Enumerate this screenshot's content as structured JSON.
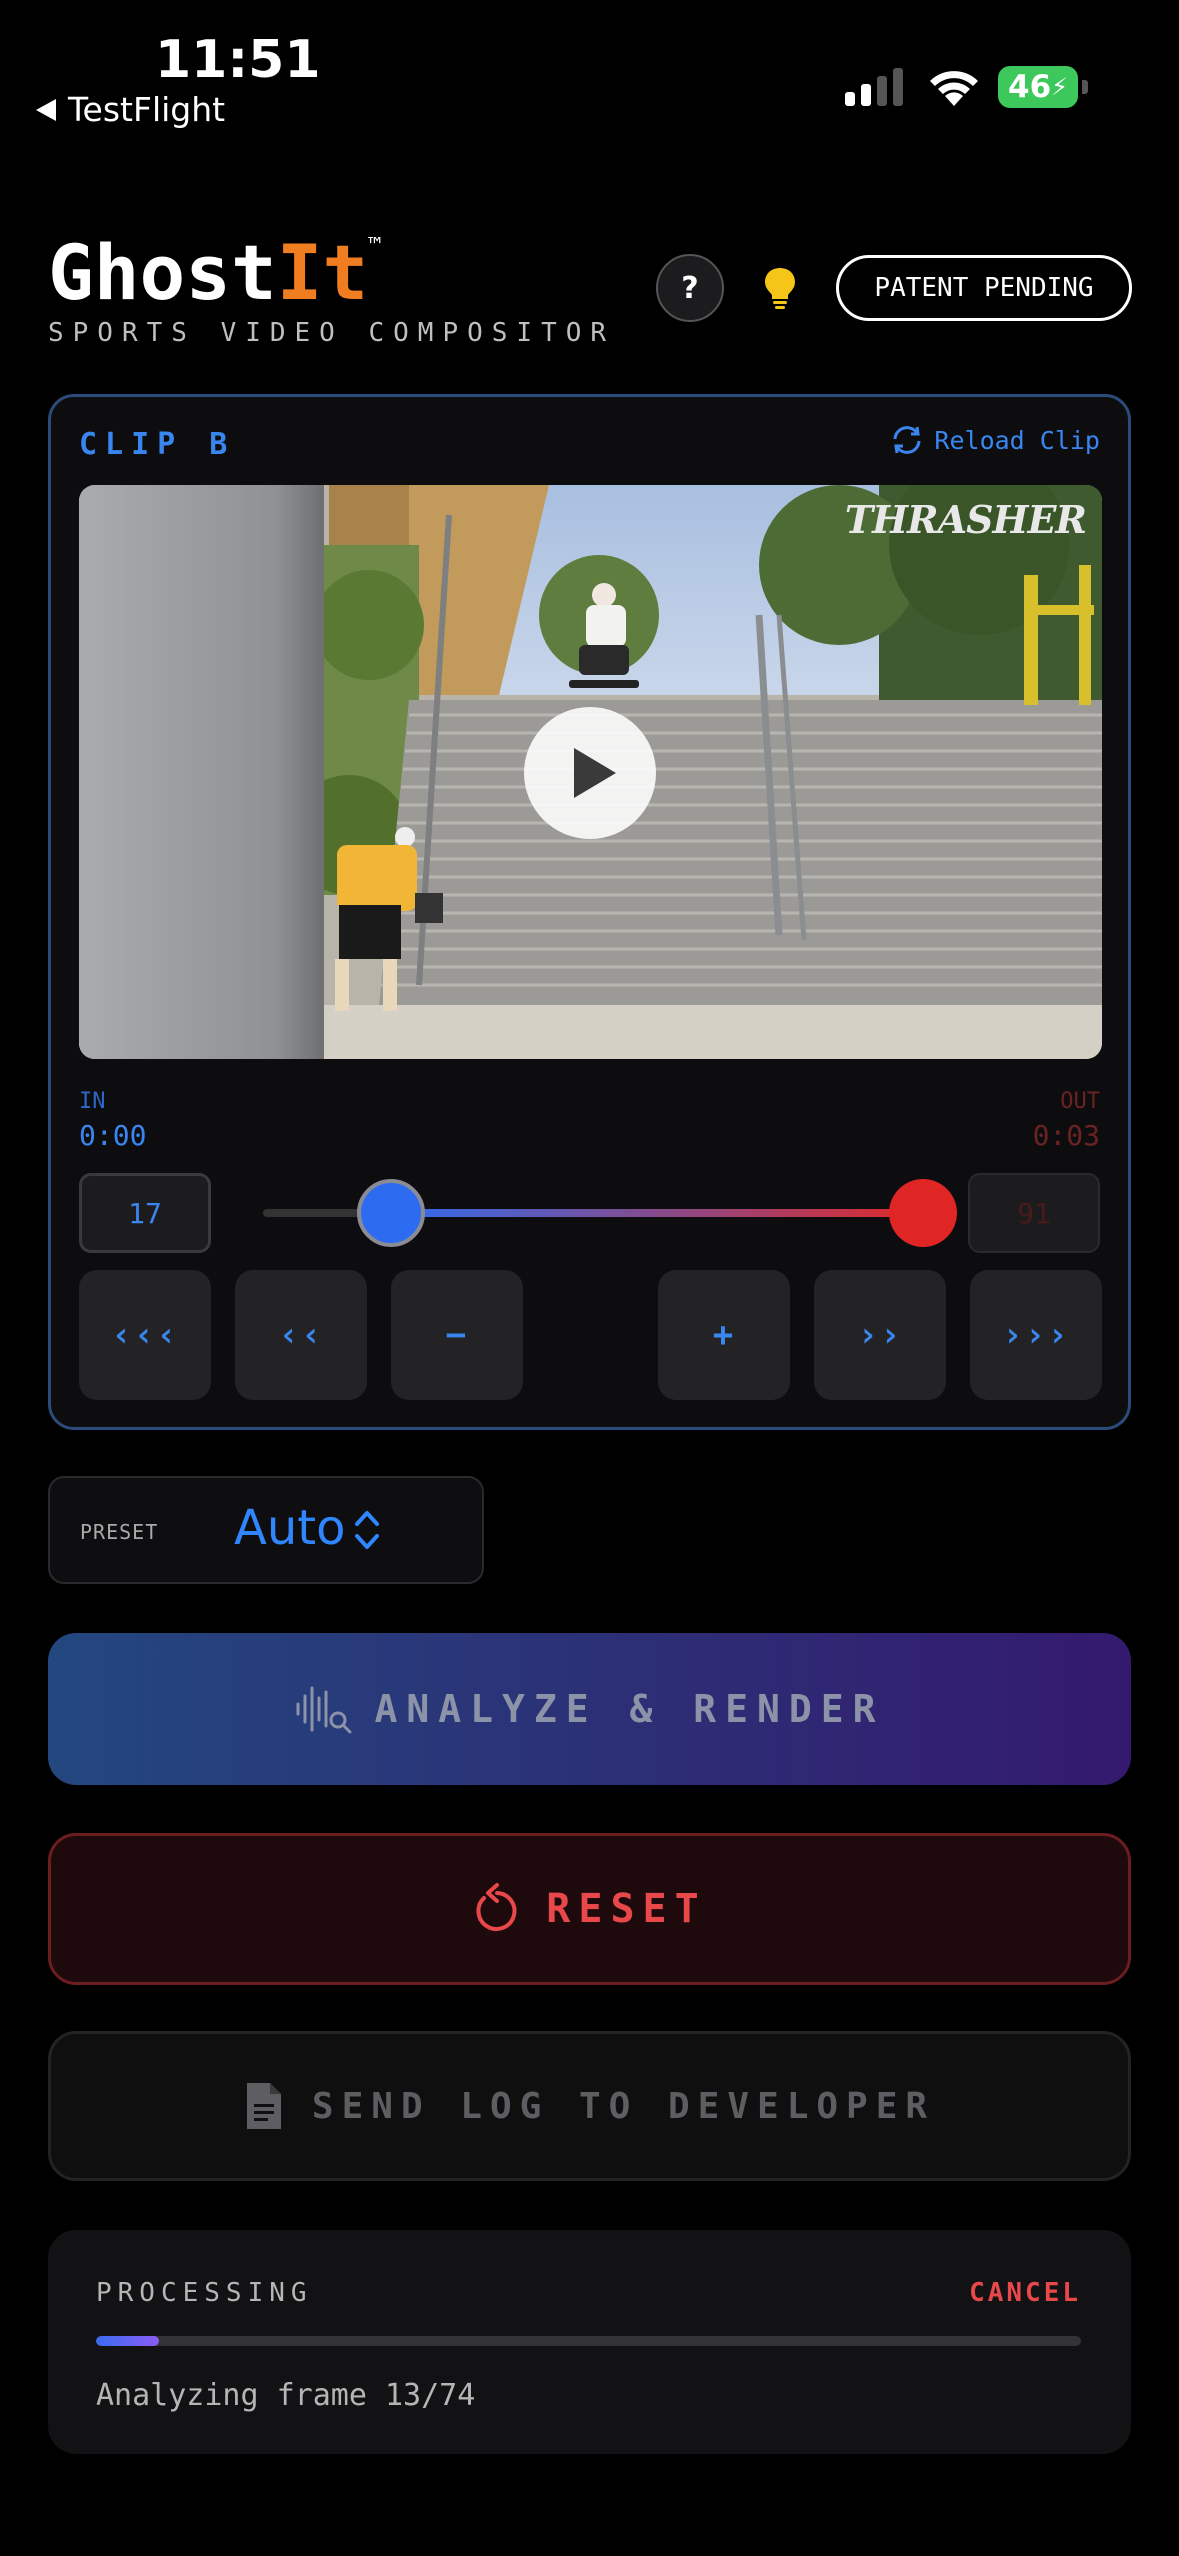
{
  "status_bar": {
    "time": "11:51",
    "back_label": "TestFlight",
    "battery": "46"
  },
  "header": {
    "logo_part1": "Ghost",
    "logo_part2": "It",
    "trademark": "™",
    "subtitle": "SPORTS VIDEO COMPOSITOR",
    "help_label": "?",
    "patent_label": "PATENT PENDING",
    "accent_color": "#f07d20"
  },
  "clip": {
    "title": "CLIP B",
    "reload_label": "Reload Clip",
    "video_watermark": "THRASHER",
    "in_label": "IN",
    "in_time": "0:00",
    "out_label": "OUT",
    "out_time": "0:03",
    "in_frame": "17",
    "out_frame": "91",
    "step_buttons": [
      "‹‹‹",
      "‹‹",
      "−",
      "+",
      "››",
      "›››"
    ]
  },
  "preset": {
    "label": "PRESET",
    "value": "Auto"
  },
  "actions": {
    "analyze_label": "ANALYZE & RENDER",
    "reset_label": "RESET",
    "log_label": "SEND LOG TO DEVELOPER"
  },
  "processing": {
    "label": "PROCESSING",
    "cancel_label": "CANCEL",
    "progress": 0.064,
    "status_text": "Analyzing frame 13/74"
  }
}
